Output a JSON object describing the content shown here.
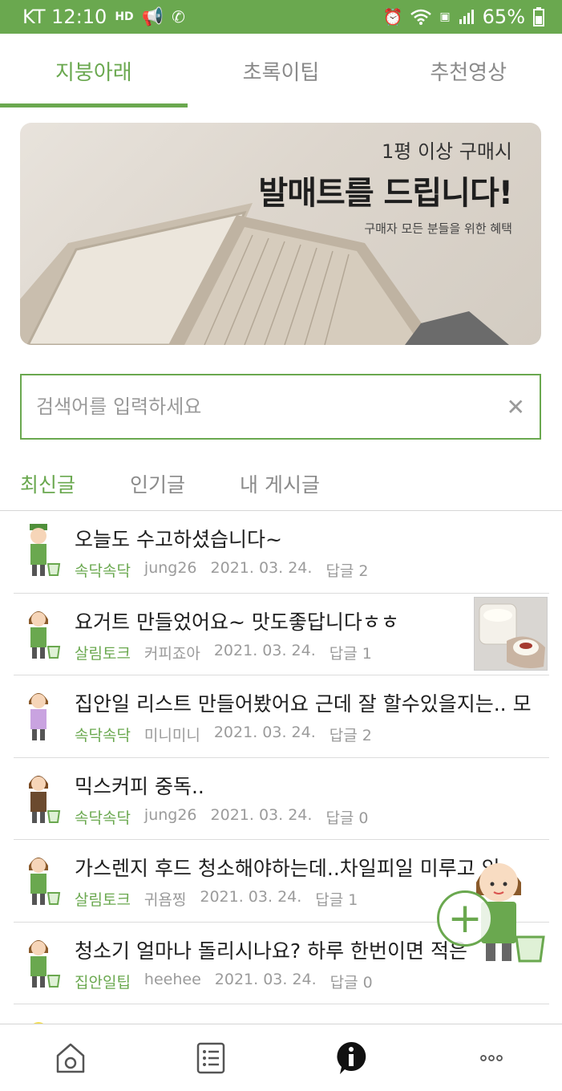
{
  "status_bar": {
    "carrier_time": "KT 12:10",
    "hd_label": "HD",
    "battery": "65%"
  },
  "tabs": [
    {
      "label": "지붕아래",
      "active": true
    },
    {
      "label": "초록이팁",
      "active": false
    },
    {
      "label": "추천영상",
      "active": false
    }
  ],
  "banner": {
    "line1": "1평 이상 구매시",
    "line2": "발매트를 드립니다!",
    "line3": "구매자 모든 분들을 위한 혜택"
  },
  "search": {
    "placeholder": "검색어를 입력하세요",
    "value": ""
  },
  "sub_tabs": [
    {
      "label": "최신글",
      "active": true
    },
    {
      "label": "인기글",
      "active": false
    },
    {
      "label": "내 게시글",
      "active": false
    }
  ],
  "posts": [
    {
      "title": "오늘도 수고하셨습니다~",
      "category": "속닥속닥",
      "author": "jung26",
      "date": "2021. 03. 24.",
      "replies": "답글 2",
      "avatar": "green-hat",
      "has_thumb": false
    },
    {
      "title": "요거트 만들었어요~  맛도좋답니다ㅎㅎ",
      "category": "살림토크",
      "author": "커피죠아",
      "date": "2021. 03. 24.",
      "replies": "답글 1",
      "avatar": "green-apron",
      "has_thumb": true
    },
    {
      "title": "집안일 리스트 만들어봤어요 근데 잘 할수있을지는.. 모",
      "category": "속닥속닥",
      "author": "미니미니",
      "date": "2021. 03. 24.",
      "replies": "답글 2",
      "avatar": "purple-apron",
      "has_thumb": false
    },
    {
      "title": "믹스커피 중독..",
      "category": "속닥속닥",
      "author": "jung26",
      "date": "2021. 03. 24.",
      "replies": "답글 0",
      "avatar": "brown-apron",
      "has_thumb": false
    },
    {
      "title": "가스렌지 후드 청소해야하는데..차일피일 미루고 있",
      "category": "살림토크",
      "author": "귀욤찡",
      "date": "2021. 03. 24.",
      "replies": "답글 1",
      "avatar": "green-apron",
      "has_thumb": false
    },
    {
      "title": "청소기 얼마나 돌리시나요?  하루 한번이면 적은",
      "category": "집안일팁",
      "author": "heehee",
      "date": "2021. 03. 24.",
      "replies": "답글 0",
      "avatar": "green-apron",
      "has_thumb": false
    }
  ],
  "fab": {
    "label": "+"
  },
  "colors": {
    "accent": "#6aa84f",
    "text": "#1e1e1e",
    "muted": "#9b9b9b"
  },
  "bottom_nav": [
    {
      "icon": "home-icon"
    },
    {
      "icon": "list-icon"
    },
    {
      "icon": "info-icon"
    },
    {
      "icon": "more-icon"
    }
  ]
}
